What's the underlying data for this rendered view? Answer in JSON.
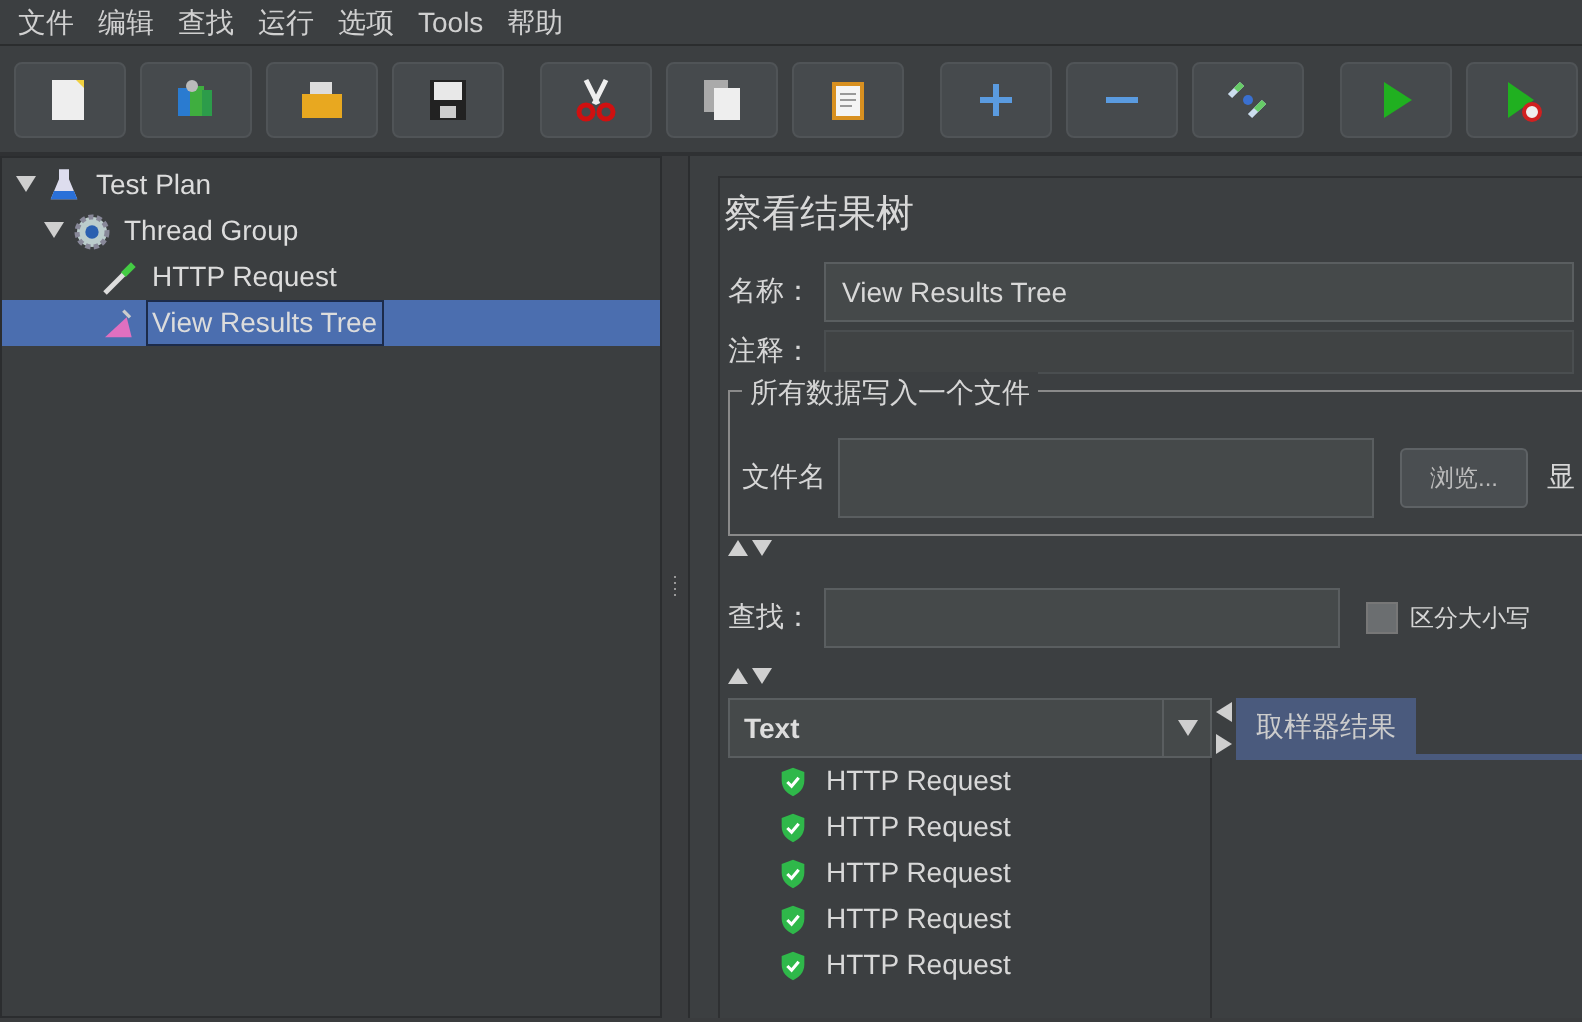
{
  "menu": [
    "文件",
    "编辑",
    "查找",
    "运行",
    "选项",
    "Tools",
    "帮助"
  ],
  "toolbar": [
    {
      "buttons": [
        {
          "kind": "new"
        },
        {
          "kind": "templates"
        },
        {
          "kind": "open"
        },
        {
          "kind": "save"
        }
      ]
    },
    {
      "buttons": [
        {
          "kind": "cut"
        },
        {
          "kind": "copy"
        },
        {
          "kind": "paste"
        }
      ]
    },
    {
      "buttons": [
        {
          "kind": "expand"
        },
        {
          "kind": "collapse"
        },
        {
          "kind": "toggle"
        }
      ]
    },
    {
      "buttons": [
        {
          "kind": "start"
        },
        {
          "kind": "start-no-pause"
        }
      ]
    }
  ],
  "tree": [
    {
      "label": "Test Plan",
      "kind": "plan",
      "expanded": true,
      "selected": false,
      "children": [
        {
          "label": "Thread Group",
          "kind": "threads",
          "expanded": true,
          "selected": false,
          "children": [
            {
              "label": "HTTP Request",
              "kind": "sampler",
              "selected": false
            },
            {
              "label": "View Results Tree",
              "kind": "listener",
              "selected": true
            }
          ]
        }
      ]
    }
  ],
  "panel": {
    "title": "察看结果树",
    "name_label": "名称：",
    "name_value": "View Results Tree",
    "comment_label": "注释：",
    "file_group": {
      "legend": "所有数据写入一个文件",
      "file_label": "文件名",
      "browse_button": "浏览...",
      "cut_label": "显"
    },
    "search": {
      "label": "查找：",
      "case_label": "区分大小写",
      "case_checked": false
    },
    "renderer": {
      "value": "Text"
    },
    "results": [
      {
        "label": "HTTP Request",
        "success": true
      },
      {
        "label": "HTTP Request",
        "success": true
      },
      {
        "label": "HTTP Request",
        "success": true
      },
      {
        "label": "HTTP Request",
        "success": true
      },
      {
        "label": "HTTP Request",
        "success": true
      }
    ],
    "tabs": [
      {
        "label": "取样器结果",
        "selected": true
      }
    ]
  }
}
